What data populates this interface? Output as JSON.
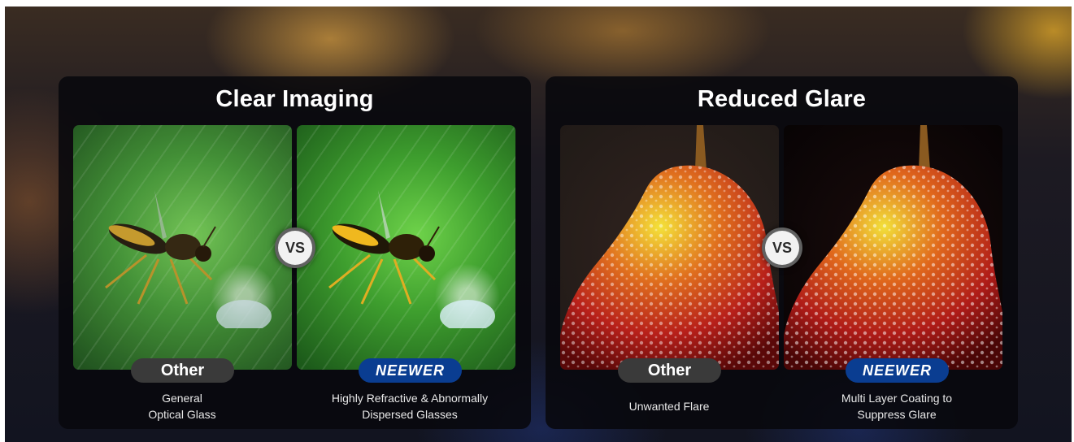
{
  "panels": [
    {
      "title": "Clear Imaging",
      "vs_label": "VS",
      "left": {
        "tag": "Other",
        "caption_line1": "General",
        "caption_line2": "Optical Glass"
      },
      "right": {
        "tag": "NEEWER",
        "caption_line1": "Highly Refractive & Abnormally",
        "caption_line2": "Dispersed Glasses"
      }
    },
    {
      "title": "Reduced Glare",
      "vs_label": "VS",
      "left": {
        "tag": "Other",
        "caption_line1": "Unwanted Flare"
      },
      "right": {
        "tag": "NEEWER",
        "caption_line1": "Multi Layer Coating to",
        "caption_line2": "Suppress Glare"
      }
    }
  ],
  "colors": {
    "panel_bg": "#08080c",
    "neewer_blue": "#0a3d91",
    "other_gray": "#3a3a3a"
  }
}
